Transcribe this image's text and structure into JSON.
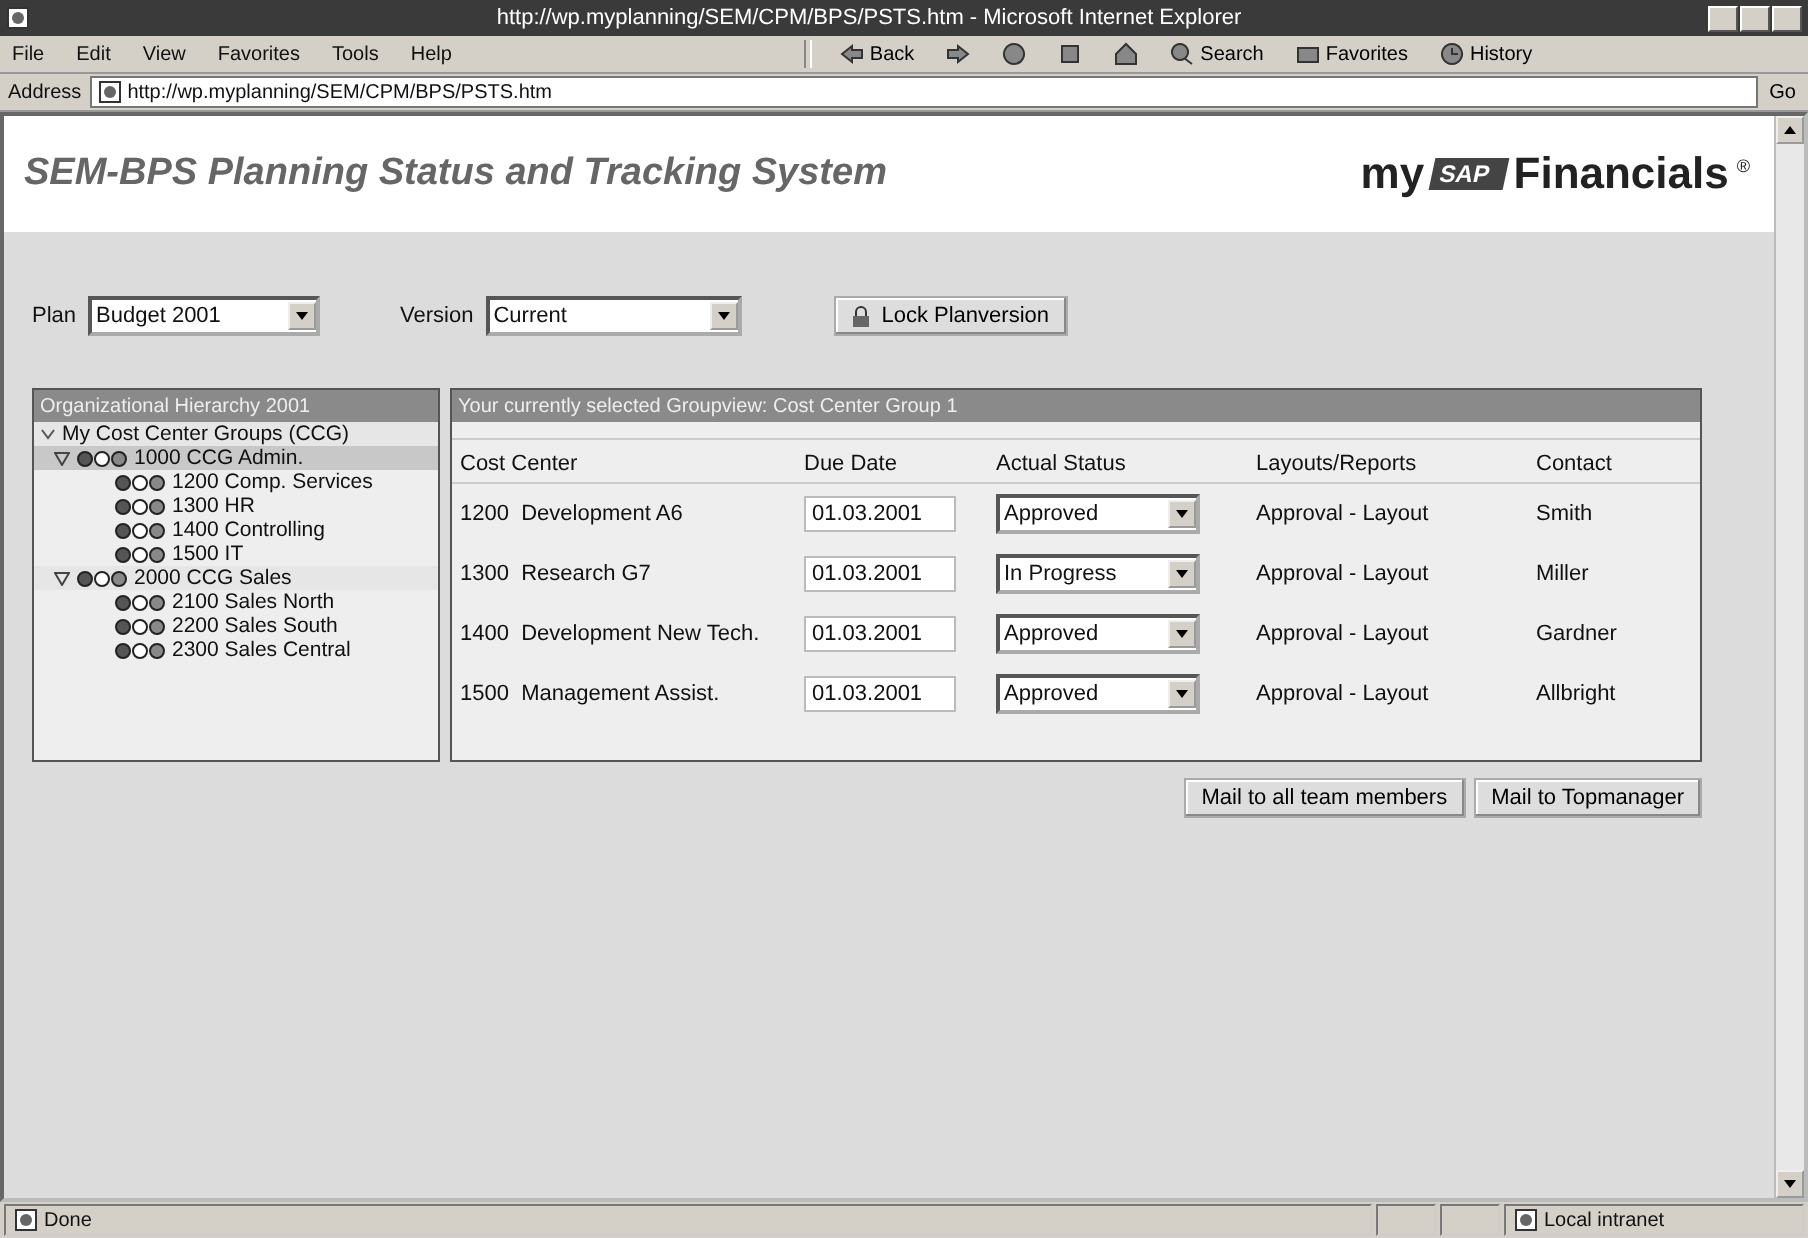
{
  "window": {
    "title": "http://wp.myplanning/SEM/CPM/BPS/PSTS.htm - Microsoft Internet Explorer"
  },
  "menu": [
    "File",
    "Edit",
    "View",
    "Favorites",
    "Tools",
    "Help"
  ],
  "toolbar": [
    {
      "kind": "back",
      "label": "Back"
    },
    {
      "kind": "forward"
    },
    {
      "kind": "stop"
    },
    {
      "kind": "refresh"
    },
    {
      "kind": "home"
    },
    {
      "kind": "search",
      "label": "Search"
    },
    {
      "kind": "favorites",
      "label": "Favorites"
    },
    {
      "kind": "history",
      "label": "History"
    }
  ],
  "address": {
    "label": "Address",
    "value": "http://wp.myplanning/SEM/CPM/BPS/PSTS.htm",
    "go": "Go"
  },
  "page": {
    "title": "SEM-BPS Planning Status and Tracking System",
    "brand_prefix": "my",
    "brand_badge": "SAP",
    "brand_suffix": "Financials",
    "brand_mark": "®"
  },
  "filters": {
    "plan_label": "Plan",
    "plan_value": "Budget 2001",
    "version_label": "Version",
    "version_value": "Current",
    "lock_button": "Lock Planversion"
  },
  "hierarchy": {
    "title": "Organizational Hierarchy 2001",
    "tree": [
      {
        "label": "My Cost Center Groups (CCG)",
        "expanded": true,
        "selected": false,
        "children": [
          {
            "label": "1000 CCG Admin.",
            "expanded": true,
            "selected": true,
            "children": [
              {
                "label": "1200 Comp. Services",
                "selected": false
              },
              {
                "label": "1300 HR",
                "selected": false
              },
              {
                "label": "1400 Controlling",
                "selected": false
              },
              {
                "label": "1500 IT",
                "selected": false
              }
            ]
          },
          {
            "label": "2000 CCG Sales",
            "expanded": true,
            "selected": false,
            "children": [
              {
                "label": "2100 Sales North",
                "selected": false
              },
              {
                "label": "2200 Sales South",
                "selected": false
              },
              {
                "label": "2300 Sales Central",
                "selected": false
              }
            ]
          }
        ]
      }
    ]
  },
  "groupview": {
    "title": "Your currently selected Groupview: Cost Center Group 1",
    "columns": [
      "Cost Center",
      "Due Date",
      "Actual Status",
      "Layouts/Reports",
      "Contact"
    ],
    "rows": [
      {
        "id": "1200",
        "name": "Development A6",
        "due": "01.03.2001",
        "status": "Approved",
        "layout": "Approval - Layout",
        "contact": "Smith"
      },
      {
        "id": "1300",
        "name": "Research G7",
        "due": "01.03.2001",
        "status": "In Progress",
        "layout": "Approval - Layout",
        "contact": "Miller"
      },
      {
        "id": "1400",
        "name": "Development New Tech.",
        "due": "01.03.2001",
        "status": "Approved",
        "layout": "Approval - Layout",
        "contact": "Gardner"
      },
      {
        "id": "1500",
        "name": "Management Assist.",
        "due": "01.03.2001",
        "status": "Approved",
        "layout": "Approval - Layout",
        "contact": "Allbright"
      }
    ]
  },
  "actions": [
    "Mail to all team members",
    "Mail to Topmanager"
  ],
  "status_bar": {
    "text": "Done",
    "zone": "Local intranet"
  }
}
